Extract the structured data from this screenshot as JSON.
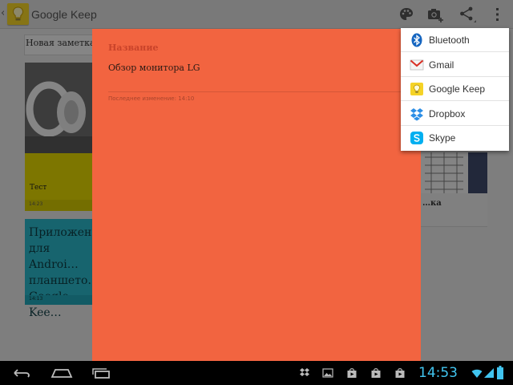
{
  "app": {
    "title": "Google Keep",
    "back_icon": "chevron-left-icon",
    "logo_icon": "lightbulb-icon",
    "accent_color": "#f5d327"
  },
  "actionbar": {
    "icons": [
      "palette-icon",
      "camera-add-icon",
      "share-icon",
      "overflow-menu-icon"
    ]
  },
  "background_notes": {
    "new_note_label": "Новая заметка",
    "cards": [
      {
        "title": "Тест",
        "time": "14:23",
        "color": "#e3d800"
      },
      {
        "text": "Приложен…\nдля Androi…\nпланшето…\nGoogle Kee…",
        "time": "14:13",
        "color": "#2ab7c9"
      },
      {
        "title": "…ка",
        "color": "#e9e9e9"
      }
    ]
  },
  "editor": {
    "title_placeholder": "Название",
    "body": "Обзор монитора LG",
    "last_edited": "Последнее изменение: 14:10",
    "color": "#f26440"
  },
  "share_menu": {
    "items": [
      {
        "label": "Bluetooth",
        "icon": "bluetooth-icon"
      },
      {
        "label": "Gmail",
        "icon": "gmail-icon"
      },
      {
        "label": "Google Keep",
        "icon": "google-keep-icon"
      },
      {
        "label": "Dropbox",
        "icon": "dropbox-icon"
      },
      {
        "label": "Skype",
        "icon": "skype-icon"
      }
    ]
  },
  "system_bar": {
    "time": "14:53",
    "clock_color": "#41c5f0",
    "nav": [
      "back-icon",
      "home-icon",
      "recents-icon"
    ],
    "notifications": [
      "dropbox-notification-icon",
      "image-notification-icon",
      "store-notification-icon",
      "store-notification-icon",
      "store-notification-icon"
    ],
    "status": [
      "wifi-icon",
      "signal-icon",
      "battery-icon"
    ]
  }
}
